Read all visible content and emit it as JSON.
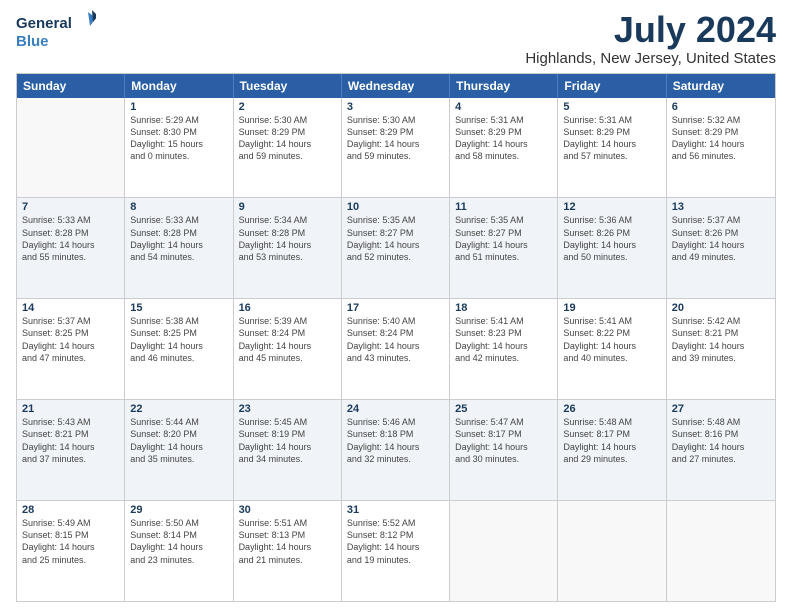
{
  "logo": {
    "general": "General",
    "blue": "Blue"
  },
  "title": "July 2024",
  "subtitle": "Highlands, New Jersey, United States",
  "days_header": [
    "Sunday",
    "Monday",
    "Tuesday",
    "Wednesday",
    "Thursday",
    "Friday",
    "Saturday"
  ],
  "weeks": [
    [
      {
        "day": "",
        "info": "",
        "empty": true
      },
      {
        "day": "1",
        "info": "Sunrise: 5:29 AM\nSunset: 8:30 PM\nDaylight: 15 hours\nand 0 minutes."
      },
      {
        "day": "2",
        "info": "Sunrise: 5:30 AM\nSunset: 8:29 PM\nDaylight: 14 hours\nand 59 minutes."
      },
      {
        "day": "3",
        "info": "Sunrise: 5:30 AM\nSunset: 8:29 PM\nDaylight: 14 hours\nand 59 minutes."
      },
      {
        "day": "4",
        "info": "Sunrise: 5:31 AM\nSunset: 8:29 PM\nDaylight: 14 hours\nand 58 minutes."
      },
      {
        "day": "5",
        "info": "Sunrise: 5:31 AM\nSunset: 8:29 PM\nDaylight: 14 hours\nand 57 minutes."
      },
      {
        "day": "6",
        "info": "Sunrise: 5:32 AM\nSunset: 8:29 PM\nDaylight: 14 hours\nand 56 minutes."
      }
    ],
    [
      {
        "day": "7",
        "info": "Sunrise: 5:33 AM\nSunset: 8:28 PM\nDaylight: 14 hours\nand 55 minutes."
      },
      {
        "day": "8",
        "info": "Sunrise: 5:33 AM\nSunset: 8:28 PM\nDaylight: 14 hours\nand 54 minutes."
      },
      {
        "day": "9",
        "info": "Sunrise: 5:34 AM\nSunset: 8:28 PM\nDaylight: 14 hours\nand 53 minutes."
      },
      {
        "day": "10",
        "info": "Sunrise: 5:35 AM\nSunset: 8:27 PM\nDaylight: 14 hours\nand 52 minutes."
      },
      {
        "day": "11",
        "info": "Sunrise: 5:35 AM\nSunset: 8:27 PM\nDaylight: 14 hours\nand 51 minutes."
      },
      {
        "day": "12",
        "info": "Sunrise: 5:36 AM\nSunset: 8:26 PM\nDaylight: 14 hours\nand 50 minutes."
      },
      {
        "day": "13",
        "info": "Sunrise: 5:37 AM\nSunset: 8:26 PM\nDaylight: 14 hours\nand 49 minutes."
      }
    ],
    [
      {
        "day": "14",
        "info": "Sunrise: 5:37 AM\nSunset: 8:25 PM\nDaylight: 14 hours\nand 47 minutes."
      },
      {
        "day": "15",
        "info": "Sunrise: 5:38 AM\nSunset: 8:25 PM\nDaylight: 14 hours\nand 46 minutes."
      },
      {
        "day": "16",
        "info": "Sunrise: 5:39 AM\nSunset: 8:24 PM\nDaylight: 14 hours\nand 45 minutes."
      },
      {
        "day": "17",
        "info": "Sunrise: 5:40 AM\nSunset: 8:24 PM\nDaylight: 14 hours\nand 43 minutes."
      },
      {
        "day": "18",
        "info": "Sunrise: 5:41 AM\nSunset: 8:23 PM\nDaylight: 14 hours\nand 42 minutes."
      },
      {
        "day": "19",
        "info": "Sunrise: 5:41 AM\nSunset: 8:22 PM\nDaylight: 14 hours\nand 40 minutes."
      },
      {
        "day": "20",
        "info": "Sunrise: 5:42 AM\nSunset: 8:21 PM\nDaylight: 14 hours\nand 39 minutes."
      }
    ],
    [
      {
        "day": "21",
        "info": "Sunrise: 5:43 AM\nSunset: 8:21 PM\nDaylight: 14 hours\nand 37 minutes."
      },
      {
        "day": "22",
        "info": "Sunrise: 5:44 AM\nSunset: 8:20 PM\nDaylight: 14 hours\nand 35 minutes."
      },
      {
        "day": "23",
        "info": "Sunrise: 5:45 AM\nSunset: 8:19 PM\nDaylight: 14 hours\nand 34 minutes."
      },
      {
        "day": "24",
        "info": "Sunrise: 5:46 AM\nSunset: 8:18 PM\nDaylight: 14 hours\nand 32 minutes."
      },
      {
        "day": "25",
        "info": "Sunrise: 5:47 AM\nSunset: 8:17 PM\nDaylight: 14 hours\nand 30 minutes."
      },
      {
        "day": "26",
        "info": "Sunrise: 5:48 AM\nSunset: 8:17 PM\nDaylight: 14 hours\nand 29 minutes."
      },
      {
        "day": "27",
        "info": "Sunrise: 5:48 AM\nSunset: 8:16 PM\nDaylight: 14 hours\nand 27 minutes."
      }
    ],
    [
      {
        "day": "28",
        "info": "Sunrise: 5:49 AM\nSunset: 8:15 PM\nDaylight: 14 hours\nand 25 minutes."
      },
      {
        "day": "29",
        "info": "Sunrise: 5:50 AM\nSunset: 8:14 PM\nDaylight: 14 hours\nand 23 minutes."
      },
      {
        "day": "30",
        "info": "Sunrise: 5:51 AM\nSunset: 8:13 PM\nDaylight: 14 hours\nand 21 minutes."
      },
      {
        "day": "31",
        "info": "Sunrise: 5:52 AM\nSunset: 8:12 PM\nDaylight: 14 hours\nand 19 minutes."
      },
      {
        "day": "",
        "info": "",
        "empty": true
      },
      {
        "day": "",
        "info": "",
        "empty": true
      },
      {
        "day": "",
        "info": "",
        "empty": true
      }
    ]
  ],
  "colors": {
    "header_bg": "#2a5fa5",
    "shaded_bg": "#f0f4f8",
    "empty_bg": "#f8f8f8"
  }
}
